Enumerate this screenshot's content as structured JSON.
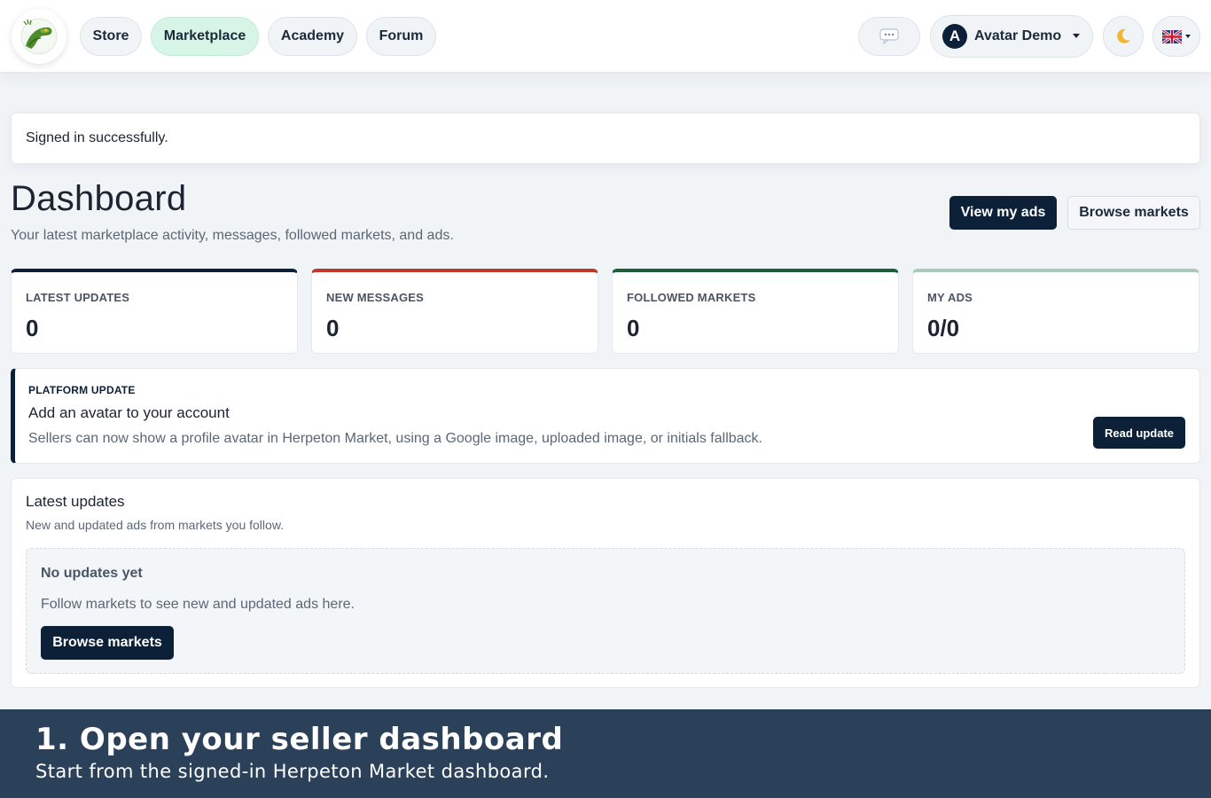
{
  "nav": {
    "logo_icon": "gecko-logo-icon",
    "items": [
      {
        "label": "Store",
        "active": false
      },
      {
        "label": "Marketplace",
        "active": true
      },
      {
        "label": "Academy",
        "active": false
      },
      {
        "label": "Forum",
        "active": false
      }
    ],
    "messages_icon": "chat-bubble-icon",
    "user": {
      "initial": "A",
      "name": "Avatar Demo"
    },
    "theme_icon": "crescent-moon-icon",
    "language_icon": "uk-flag-icon"
  },
  "flash": {
    "message": "Signed in successfully."
  },
  "header": {
    "title": "Dashboard",
    "subtitle": "Your latest marketplace activity, messages, followed markets, and ads.",
    "primary_button": "View my ads",
    "secondary_button": "Browse markets"
  },
  "stats": [
    {
      "label": "LATEST UPDATES",
      "value": "0",
      "accent": "#0c2038"
    },
    {
      "label": "NEW MESSAGES",
      "value": "0",
      "accent": "#c0392b"
    },
    {
      "label": "FOLLOWED MARKETS",
      "value": "0",
      "accent": "#1e5e3a"
    },
    {
      "label": "MY ADS",
      "value": "0/0",
      "accent": "#a9c9bb"
    }
  ],
  "platform_update": {
    "tag": "PLATFORM UPDATE",
    "title": "Add an avatar to your account",
    "description": "Sellers can now show a profile avatar in Herpeton Market, using a Google image, uploaded image, or initials fallback.",
    "button": "Read update"
  },
  "latest_updates": {
    "title": "Latest updates",
    "subtitle": "New and updated ads from markets you follow.",
    "empty_title": "No updates yet",
    "empty_text": "Follow markets to see new and updated ads here.",
    "empty_button": "Browse markets"
  },
  "caption": {
    "title": "1. Open your seller dashboard",
    "subtitle": "Start from the signed-in Herpeton Market dashboard."
  },
  "colors": {
    "primary": "#0c2038",
    "background": "#f1f4f7",
    "active_nav": "#d6f5e6",
    "caption_bg": "#2b4159"
  }
}
